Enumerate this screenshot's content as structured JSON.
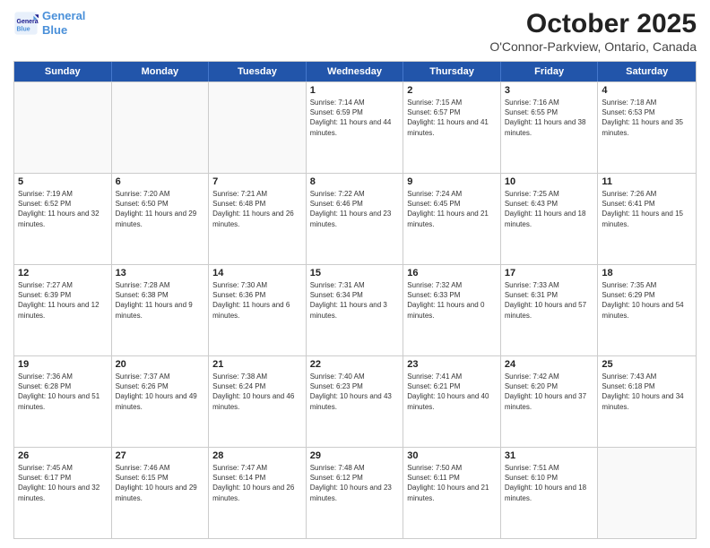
{
  "header": {
    "logo_line1": "General",
    "logo_line2": "Blue",
    "title": "October 2025",
    "subtitle": "O'Connor-Parkview, Ontario, Canada"
  },
  "weekdays": [
    "Sunday",
    "Monday",
    "Tuesday",
    "Wednesday",
    "Thursday",
    "Friday",
    "Saturday"
  ],
  "weeks": [
    [
      {
        "day": "",
        "sunrise": "",
        "sunset": "",
        "daylight": ""
      },
      {
        "day": "",
        "sunrise": "",
        "sunset": "",
        "daylight": ""
      },
      {
        "day": "",
        "sunrise": "",
        "sunset": "",
        "daylight": ""
      },
      {
        "day": "1",
        "sunrise": "Sunrise: 7:14 AM",
        "sunset": "Sunset: 6:59 PM",
        "daylight": "Daylight: 11 hours and 44 minutes."
      },
      {
        "day": "2",
        "sunrise": "Sunrise: 7:15 AM",
        "sunset": "Sunset: 6:57 PM",
        "daylight": "Daylight: 11 hours and 41 minutes."
      },
      {
        "day": "3",
        "sunrise": "Sunrise: 7:16 AM",
        "sunset": "Sunset: 6:55 PM",
        "daylight": "Daylight: 11 hours and 38 minutes."
      },
      {
        "day": "4",
        "sunrise": "Sunrise: 7:18 AM",
        "sunset": "Sunset: 6:53 PM",
        "daylight": "Daylight: 11 hours and 35 minutes."
      }
    ],
    [
      {
        "day": "5",
        "sunrise": "Sunrise: 7:19 AM",
        "sunset": "Sunset: 6:52 PM",
        "daylight": "Daylight: 11 hours and 32 minutes."
      },
      {
        "day": "6",
        "sunrise": "Sunrise: 7:20 AM",
        "sunset": "Sunset: 6:50 PM",
        "daylight": "Daylight: 11 hours and 29 minutes."
      },
      {
        "day": "7",
        "sunrise": "Sunrise: 7:21 AM",
        "sunset": "Sunset: 6:48 PM",
        "daylight": "Daylight: 11 hours and 26 minutes."
      },
      {
        "day": "8",
        "sunrise": "Sunrise: 7:22 AM",
        "sunset": "Sunset: 6:46 PM",
        "daylight": "Daylight: 11 hours and 23 minutes."
      },
      {
        "day": "9",
        "sunrise": "Sunrise: 7:24 AM",
        "sunset": "Sunset: 6:45 PM",
        "daylight": "Daylight: 11 hours and 21 minutes."
      },
      {
        "day": "10",
        "sunrise": "Sunrise: 7:25 AM",
        "sunset": "Sunset: 6:43 PM",
        "daylight": "Daylight: 11 hours and 18 minutes."
      },
      {
        "day": "11",
        "sunrise": "Sunrise: 7:26 AM",
        "sunset": "Sunset: 6:41 PM",
        "daylight": "Daylight: 11 hours and 15 minutes."
      }
    ],
    [
      {
        "day": "12",
        "sunrise": "Sunrise: 7:27 AM",
        "sunset": "Sunset: 6:39 PM",
        "daylight": "Daylight: 11 hours and 12 minutes."
      },
      {
        "day": "13",
        "sunrise": "Sunrise: 7:28 AM",
        "sunset": "Sunset: 6:38 PM",
        "daylight": "Daylight: 11 hours and 9 minutes."
      },
      {
        "day": "14",
        "sunrise": "Sunrise: 7:30 AM",
        "sunset": "Sunset: 6:36 PM",
        "daylight": "Daylight: 11 hours and 6 minutes."
      },
      {
        "day": "15",
        "sunrise": "Sunrise: 7:31 AM",
        "sunset": "Sunset: 6:34 PM",
        "daylight": "Daylight: 11 hours and 3 minutes."
      },
      {
        "day": "16",
        "sunrise": "Sunrise: 7:32 AM",
        "sunset": "Sunset: 6:33 PM",
        "daylight": "Daylight: 11 hours and 0 minutes."
      },
      {
        "day": "17",
        "sunrise": "Sunrise: 7:33 AM",
        "sunset": "Sunset: 6:31 PM",
        "daylight": "Daylight: 10 hours and 57 minutes."
      },
      {
        "day": "18",
        "sunrise": "Sunrise: 7:35 AM",
        "sunset": "Sunset: 6:29 PM",
        "daylight": "Daylight: 10 hours and 54 minutes."
      }
    ],
    [
      {
        "day": "19",
        "sunrise": "Sunrise: 7:36 AM",
        "sunset": "Sunset: 6:28 PM",
        "daylight": "Daylight: 10 hours and 51 minutes."
      },
      {
        "day": "20",
        "sunrise": "Sunrise: 7:37 AM",
        "sunset": "Sunset: 6:26 PM",
        "daylight": "Daylight: 10 hours and 49 minutes."
      },
      {
        "day": "21",
        "sunrise": "Sunrise: 7:38 AM",
        "sunset": "Sunset: 6:24 PM",
        "daylight": "Daylight: 10 hours and 46 minutes."
      },
      {
        "day": "22",
        "sunrise": "Sunrise: 7:40 AM",
        "sunset": "Sunset: 6:23 PM",
        "daylight": "Daylight: 10 hours and 43 minutes."
      },
      {
        "day": "23",
        "sunrise": "Sunrise: 7:41 AM",
        "sunset": "Sunset: 6:21 PM",
        "daylight": "Daylight: 10 hours and 40 minutes."
      },
      {
        "day": "24",
        "sunrise": "Sunrise: 7:42 AM",
        "sunset": "Sunset: 6:20 PM",
        "daylight": "Daylight: 10 hours and 37 minutes."
      },
      {
        "day": "25",
        "sunrise": "Sunrise: 7:43 AM",
        "sunset": "Sunset: 6:18 PM",
        "daylight": "Daylight: 10 hours and 34 minutes."
      }
    ],
    [
      {
        "day": "26",
        "sunrise": "Sunrise: 7:45 AM",
        "sunset": "Sunset: 6:17 PM",
        "daylight": "Daylight: 10 hours and 32 minutes."
      },
      {
        "day": "27",
        "sunrise": "Sunrise: 7:46 AM",
        "sunset": "Sunset: 6:15 PM",
        "daylight": "Daylight: 10 hours and 29 minutes."
      },
      {
        "day": "28",
        "sunrise": "Sunrise: 7:47 AM",
        "sunset": "Sunset: 6:14 PM",
        "daylight": "Daylight: 10 hours and 26 minutes."
      },
      {
        "day": "29",
        "sunrise": "Sunrise: 7:48 AM",
        "sunset": "Sunset: 6:12 PM",
        "daylight": "Daylight: 10 hours and 23 minutes."
      },
      {
        "day": "30",
        "sunrise": "Sunrise: 7:50 AM",
        "sunset": "Sunset: 6:11 PM",
        "daylight": "Daylight: 10 hours and 21 minutes."
      },
      {
        "day": "31",
        "sunrise": "Sunrise: 7:51 AM",
        "sunset": "Sunset: 6:10 PM",
        "daylight": "Daylight: 10 hours and 18 minutes."
      },
      {
        "day": "",
        "sunrise": "",
        "sunset": "",
        "daylight": ""
      }
    ]
  ]
}
